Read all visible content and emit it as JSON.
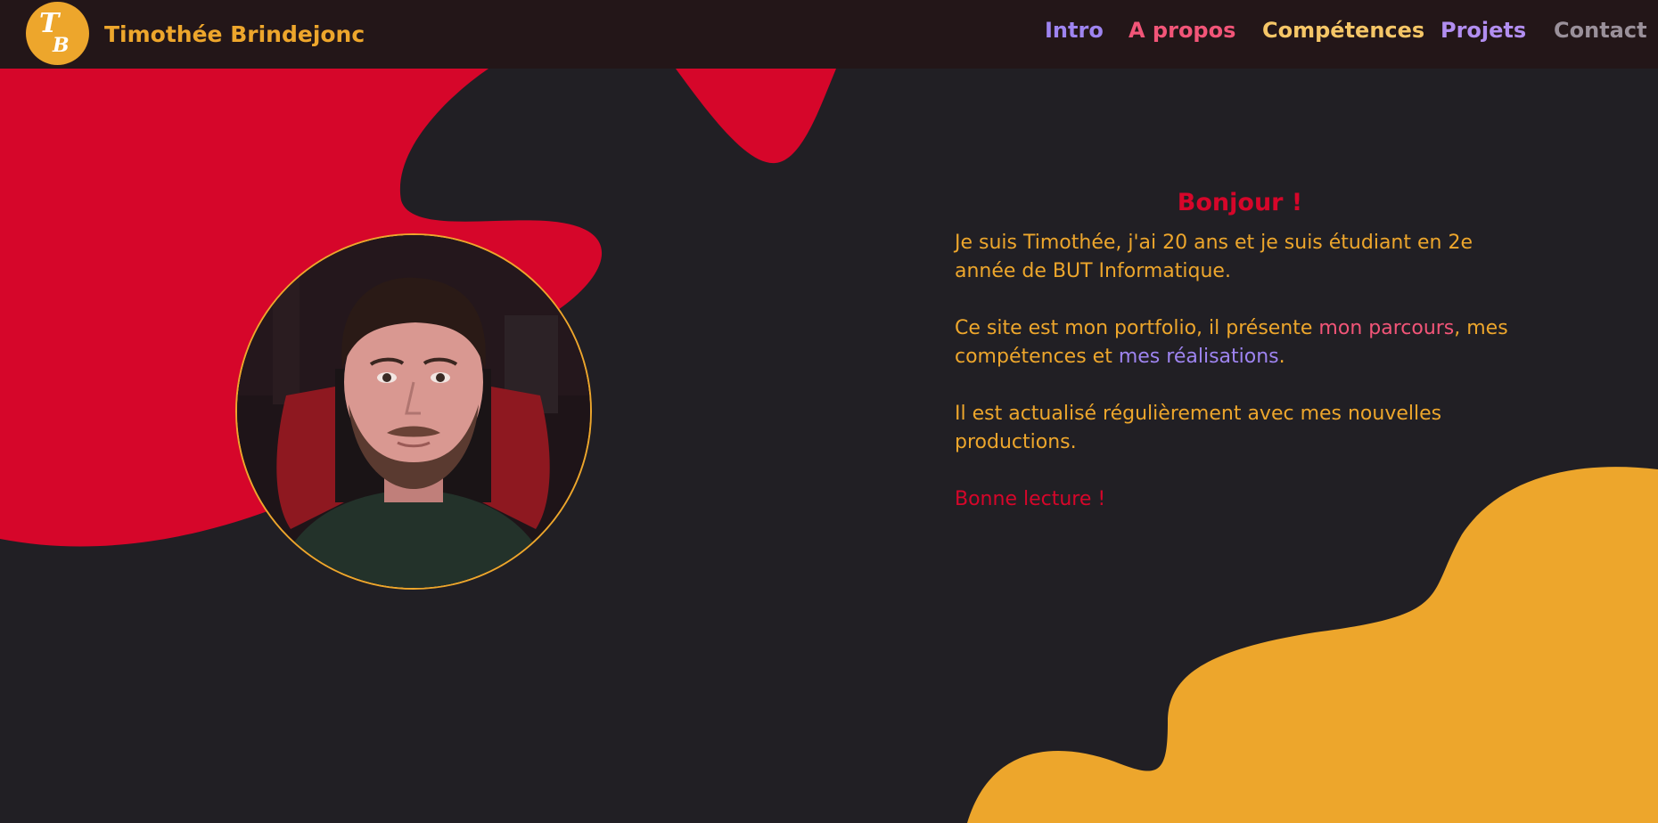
{
  "brand": {
    "name": "Timothée Brindejonc",
    "logo_initials": "TB",
    "accent_color": "#eda62c"
  },
  "nav": {
    "items": [
      {
        "label": "Intro",
        "color": "#9e84f0"
      },
      {
        "label": "A propos",
        "color": "#f25578"
      },
      {
        "label": "Compétences",
        "color": "#f5c667"
      },
      {
        "label": "Projets",
        "color": "#b28ef0"
      },
      {
        "label": "Contact",
        "color": "#9a909a"
      }
    ]
  },
  "hero": {
    "portrait_alt": "Portrait de Timothée",
    "greeting": "Bonjour !",
    "para1": "Je suis Timothée, j'ai 20 ans et je suis étudiant en 2e année de BUT Informatique.",
    "para2": {
      "before": "Ce site est mon portfolio, il présente ",
      "link1": "mon parcours",
      "mid1": ", mes compétences et ",
      "link2": "mes réalisations",
      "end": "."
    },
    "para3": "Il est actualisé régulièrement avec mes nouvelles productions.",
    "closing": "Bonne lecture !"
  },
  "colors": {
    "background": "#211f24",
    "header": "#231618",
    "red_blob": "#d6062a",
    "orange_blob": "#eda62c"
  }
}
